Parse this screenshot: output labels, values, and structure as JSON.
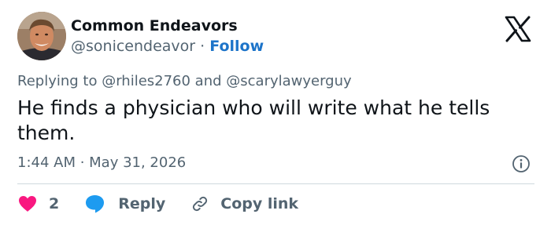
{
  "author": {
    "display_name": "Common Endeavors",
    "handle": "@sonicendeavor",
    "separator": "·",
    "follow_label": "Follow"
  },
  "icons": {
    "logo": "x-logo-icon",
    "info": "info-icon",
    "like": "heart-icon",
    "reply": "speech-bubble-icon",
    "copy": "link-icon"
  },
  "colors": {
    "follow": "#1d74c9",
    "heart": "#f91880",
    "reply_bubble": "#1d9bf0",
    "muted_text": "#536471"
  },
  "tweet": {
    "replying_to": "Replying to @rhiles2760 and @scarylawyerguy",
    "text": "He finds a physician who will write what he tells them.",
    "timestamp": "1:44 AM · May 31, 2026"
  },
  "actions": {
    "like_count": "2",
    "reply_label": "Reply",
    "copy_label": "Copy link"
  }
}
